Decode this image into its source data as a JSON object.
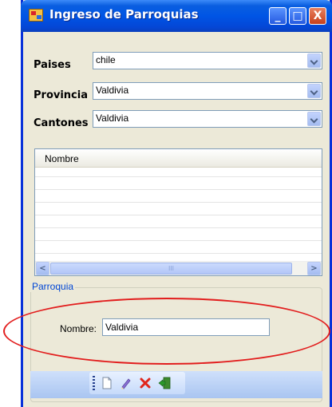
{
  "window": {
    "title": "Ingreso de Parroquias"
  },
  "titlebar_buttons": {
    "minimize": "_",
    "maximize": "□",
    "close": "X"
  },
  "form": {
    "paises": {
      "label": "Paises",
      "value": "chile"
    },
    "provincia": {
      "label": "Provincia",
      "value": "Valdivia"
    },
    "cantones": {
      "label": "Cantones",
      "value": "Valdivia"
    }
  },
  "grid": {
    "columns": [
      "Nombre"
    ],
    "rows": [],
    "scroll_left": "<",
    "scroll_right": ">",
    "thumb_grip": "III"
  },
  "group": {
    "title": "Parroquia",
    "nombre_label": "Nombre:",
    "nombre_value": "Valdivia"
  },
  "toolbar": {
    "buttons": [
      "new-icon",
      "edit-icon",
      "delete-icon",
      "exit-icon"
    ]
  },
  "colors": {
    "titlebar": "#0055e5",
    "annotation": "#e21d1d",
    "group_title": "#0046d5"
  }
}
